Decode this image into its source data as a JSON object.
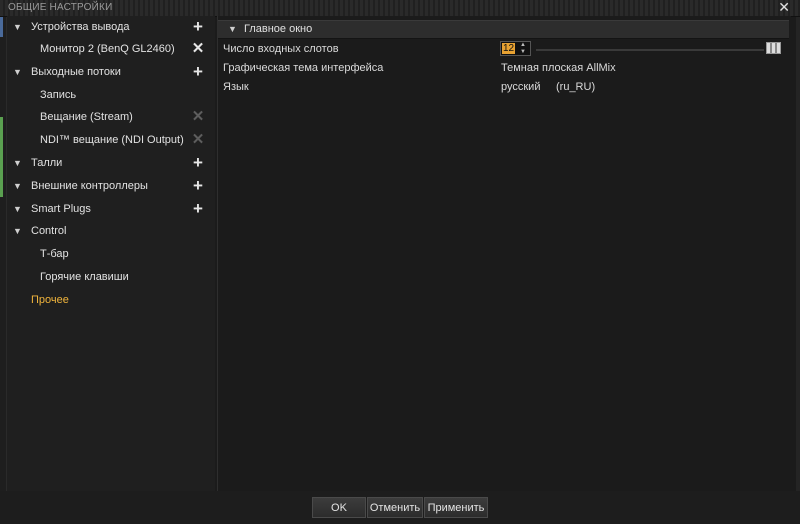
{
  "window": {
    "title": "ОБЩИЕ НАСТРОЙКИ",
    "close_icon": "close-icon"
  },
  "sidebar": {
    "items": [
      {
        "label": "Устройства вывода",
        "level": 0,
        "expanded": true,
        "action": "add"
      },
      {
        "label": "Монитор 2 (BenQ GL2460)",
        "level": 1,
        "action": "remove"
      },
      {
        "label": "Выходные потоки",
        "level": 0,
        "expanded": true,
        "action": "add"
      },
      {
        "label": "Запись",
        "level": 1
      },
      {
        "label": "Вещание (Stream)",
        "level": 1,
        "action": "remove-disabled"
      },
      {
        "label": "NDI™ вещание (NDI Output)",
        "level": 1,
        "action": "remove-disabled"
      },
      {
        "label": "Талли",
        "level": 0,
        "expanded": true,
        "action": "add"
      },
      {
        "label": "Внешние контроллеры",
        "level": 0,
        "expanded": true,
        "action": "add"
      },
      {
        "label": "Smart Plugs",
        "level": 0,
        "expanded": true,
        "action": "add"
      },
      {
        "label": "Control",
        "level": 0,
        "expanded": true
      },
      {
        "label": "Т-бар",
        "level": 1
      },
      {
        "label": "Горячие клавиши",
        "level": 1
      },
      {
        "label": "Прочее",
        "level": 0,
        "active": true
      }
    ]
  },
  "main": {
    "section_title": "Главное окно",
    "properties": {
      "slots": {
        "name": "Число входных слотов",
        "value": "12"
      },
      "theme": {
        "name": "Графическая тема интерфейса",
        "value": "Темная плоская AllMix"
      },
      "language": {
        "name": "Язык",
        "value": "русский",
        "code": "(ru_RU)"
      }
    }
  },
  "footer": {
    "ok": "OK",
    "cancel": "Отменить",
    "apply": "Применить"
  },
  "colors": {
    "accent": "#f0b43c",
    "spin_highlight": "#e8a232",
    "background": "#1b1b1b"
  }
}
